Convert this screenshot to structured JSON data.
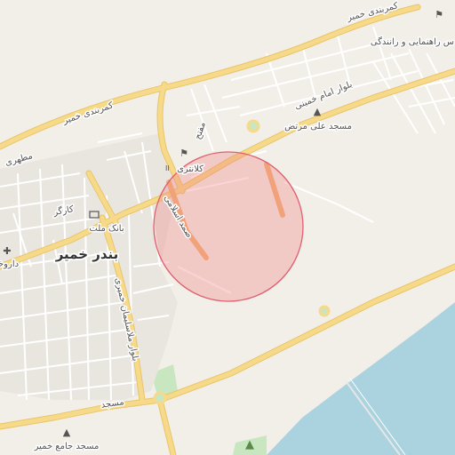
{
  "map": {
    "city_label": "بندر خمیر",
    "street_labels": {
      "coastal_road_east": "کمربندی خمیر",
      "coastal_road_west": "کمربندی خمیر",
      "imam_khomeini_blvd": "بلوار امام خمینی",
      "samad_eslami": "صمد اسلامی",
      "soleiman_khomeiri_blvd": "بلوار ملاسلیمان خمیری",
      "motahari": "مطهری",
      "masjed_street": "مسجد",
      "moftah": "مفتح",
      "kargar": "کارگر"
    },
    "pois": {
      "police": "کلانتری",
      "mosque_ali_morteza": "مسجد علی مرتض",
      "bank_mellat": "بانک ملت",
      "pharmacy": "داروخا",
      "jame_mosque": "مسجد جامع خمیر",
      "police_rahnamaei": "س راهنمایی و رانندگی"
    },
    "colors": {
      "land": "#f2efe9",
      "water": "#aad3df",
      "major_road": "#f7d98a",
      "major_road_casing": "#e8c56a",
      "minor_road": "#ffffff",
      "highlight_road": "#f2b37a",
      "radius_fill": "#f08080",
      "radius_stroke": "#e06070",
      "park": "#c8e6c0"
    },
    "icons": [
      "police-icon",
      "mosque-icon",
      "bank-icon",
      "pharmacy-icon",
      "tree-icon"
    ]
  }
}
